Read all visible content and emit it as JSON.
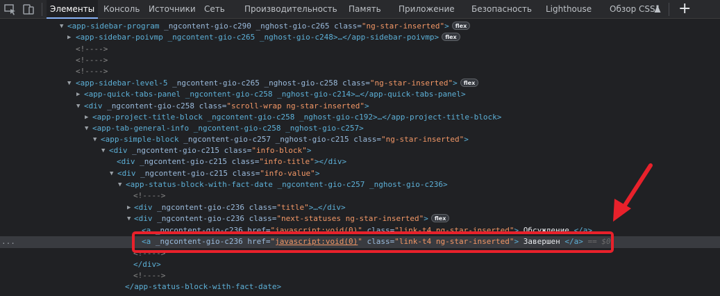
{
  "tabs": [
    {
      "label": "Элементы"
    },
    {
      "label": "Консоль"
    },
    {
      "label": "Источники"
    },
    {
      "label": "Сеть"
    },
    {
      "label": "Производительность"
    },
    {
      "label": "Память"
    },
    {
      "label": "Приложение"
    },
    {
      "label": "Безопасность"
    },
    {
      "label": "Lighthouse"
    },
    {
      "label": "Обзор CSS"
    }
  ],
  "toolbar": {
    "plus": "+",
    "flask_icon": "flask-icon"
  },
  "colors": {
    "highlight": "#e8212b",
    "tag": "#5db0d7",
    "attr_name": "#9bbbdc",
    "attr_value": "#f29766",
    "selected_row": "#393b40"
  },
  "tree": {
    "row1": {
      "open": "<app-sidebar-program",
      "attrs": " _ngcontent-gio-c290 _nghost-gio-c265 ",
      "class_attr": "class=",
      "class_val": "\"ng-star-inserted\"",
      "close": ">",
      "badge": "flex"
    },
    "row2": {
      "text": "<app-sidebar-poivmp _ngcontent-gio-c265 _nghost-gio-c248>…</app-sidebar-poivmp>",
      "badge": "flex"
    },
    "comment": "<!---->",
    "row6": {
      "open": "<app-sidebar-level-5",
      "attrs": " _ngcontent-gio-c265 _nghost-gio-c258 ",
      "class_attr": "class=",
      "class_val": "\"ng-star-inserted\"",
      "close": ">",
      "badge": "flex"
    },
    "row7": {
      "text": "<app-quick-tabs-panel _ngcontent-gio-c258 _nghost-gio-c214>…</app-quick-tabs-panel>"
    },
    "row8": {
      "open": "<div",
      "attrs": " _ngcontent-gio-c258 ",
      "class_attr": "class=",
      "class_val": "\"scroll-wrap ng-star-inserted\"",
      "close": ">"
    },
    "row9": {
      "text": "<app-project-title-block _ngcontent-gio-c258 _nghost-gio-c192>…</app-project-title-block>"
    },
    "row10": {
      "text": "<app-tab-general-info _ngcontent-gio-c258 _nghost-gio-c257>"
    },
    "row11": {
      "open": "<app-simple-block",
      "attrs": " _ngcontent-gio-c257 _nghost-gio-c215 ",
      "class_attr": "class=",
      "class_val": "\"ng-star-inserted\"",
      "close": ">"
    },
    "row12": {
      "open": "<div",
      "attrs": " _ngcontent-gio-c215 ",
      "class_attr": "class=",
      "class_val": "\"info-block\"",
      "close": ">"
    },
    "row13": {
      "open": "<div",
      "attrs": " _ngcontent-gio-c215 ",
      "class_attr": "class=",
      "class_val": "\"info-title\"",
      "close": "></div>"
    },
    "row14": {
      "open": "<div",
      "attrs": " _ngcontent-gio-c215 ",
      "class_attr": "class=",
      "class_val": "\"info-value\"",
      "close": ">"
    },
    "row15": {
      "text": "<app-status-block-with-fact-date _ngcontent-gio-c257 _nghost-gio-c236>"
    },
    "row17": {
      "open": "<div",
      "attrs": " _ngcontent-gio-c236 ",
      "class_attr": "class=",
      "class_val": "\"title\"",
      "close": ">…</div>"
    },
    "row18": {
      "open": "<div",
      "attrs": " _ngcontent-gio-c236 ",
      "class_attr": "class=",
      "class_val": "\"next-statuses ng-star-inserted\"",
      "close": ">",
      "badge": "flex"
    },
    "row19": {
      "open": "<a",
      "attrs": " _ngcontent-gio-c236 ",
      "href_attr": "href=",
      "href_val": "\"javascript:void(0)\"",
      "class_attr": " class=",
      "class_val": "\"link-t4 ng-star-inserted\"",
      "close": ">",
      "text": " Обсуждение ",
      "end": "</a>"
    },
    "row20": {
      "open": "<a",
      "attrs": " _ngcontent-gio-c236 ",
      "href_attr": "href=",
      "href_q1": "\"",
      "href_link": "javascript:void(0)",
      "href_q2": "\"",
      "class_attr": " class=",
      "class_val": "\"link-t4 ng-star-inserted\"",
      "close": ">",
      "text": " Завершен ",
      "end": "</a>",
      "dollar": " == $0"
    },
    "row22": {
      "text": "</div>"
    },
    "row24": {
      "text": "</app-status-block-with-fact-date>"
    }
  },
  "selection_dots": "..."
}
